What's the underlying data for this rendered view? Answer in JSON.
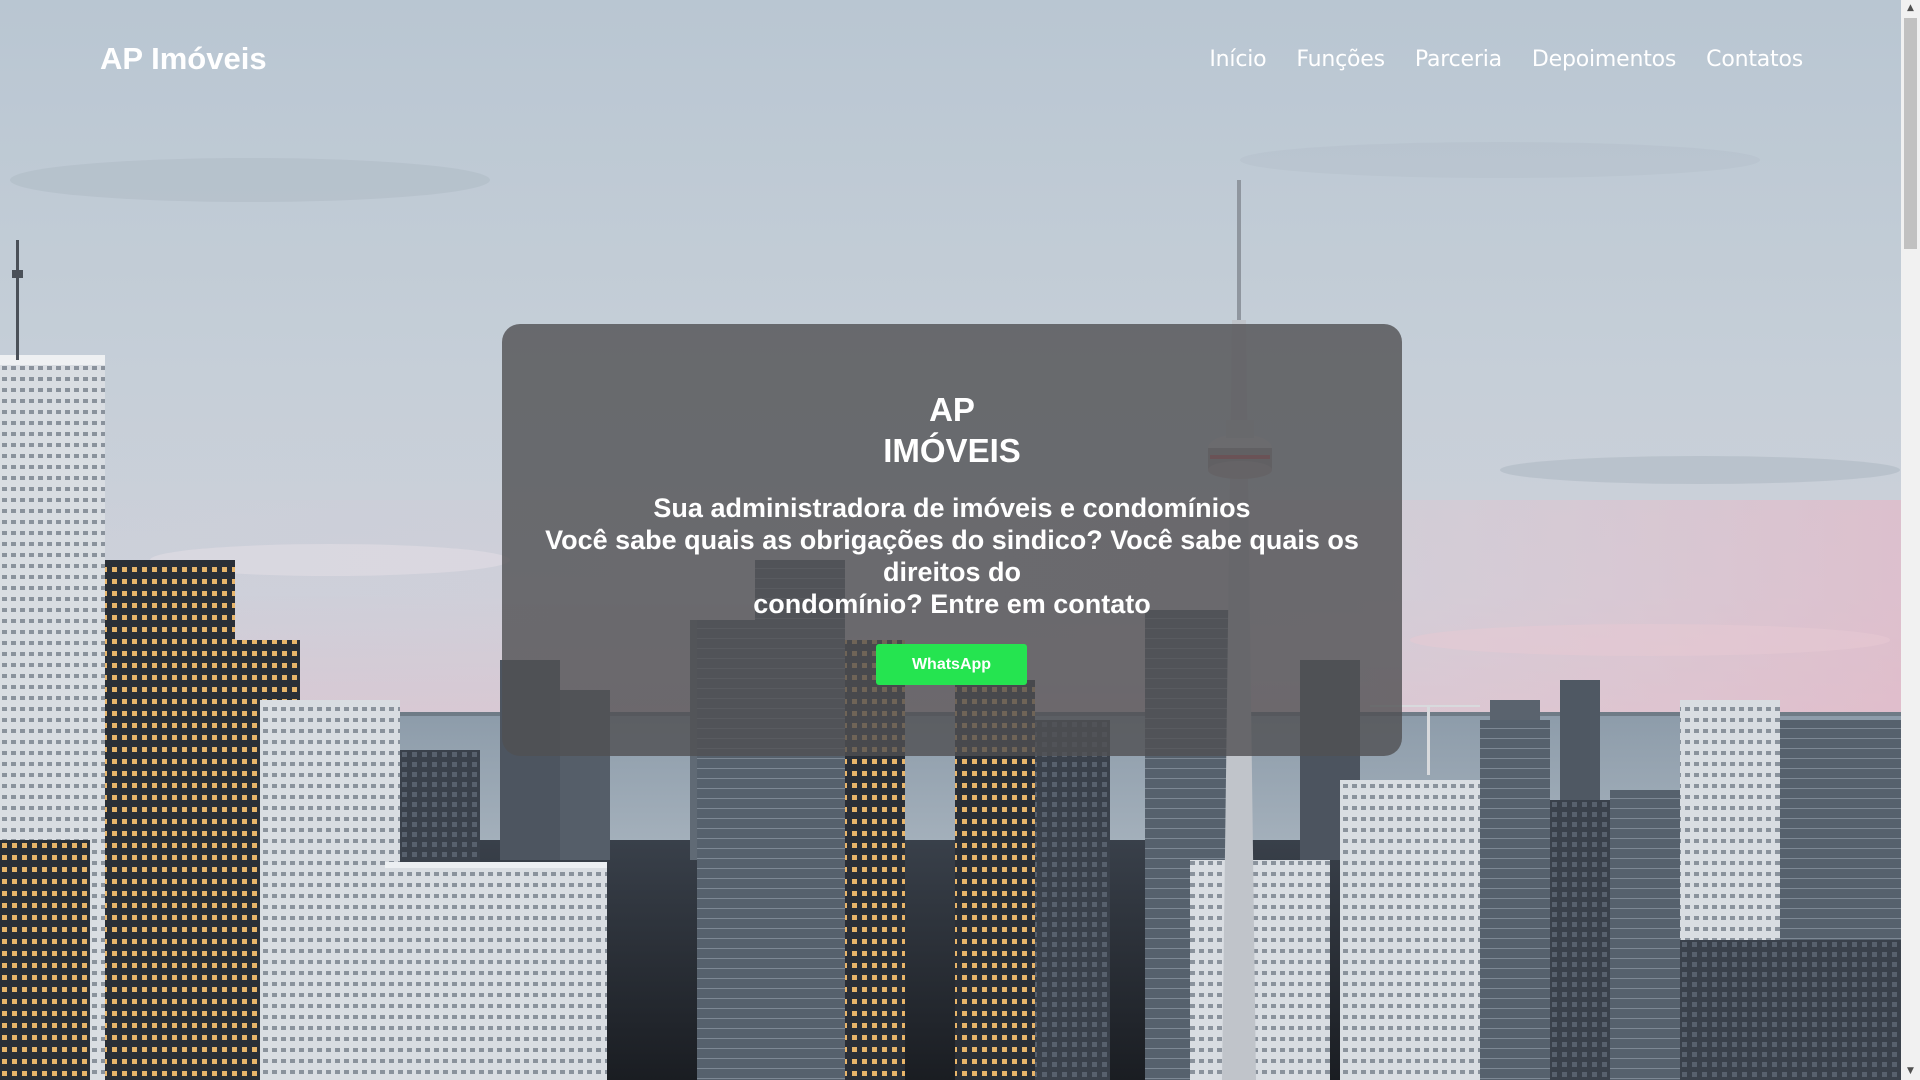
{
  "header": {
    "brand": "AP Imóveis",
    "nav": [
      {
        "label": "Início"
      },
      {
        "label": "Funções"
      },
      {
        "label": "Parceria"
      },
      {
        "label": "Depoimentos"
      },
      {
        "label": "Contatos"
      }
    ]
  },
  "hero": {
    "title_line1": "AP",
    "title_line2": "IMÓVEIS",
    "subtitle": "Sua administradora de imóveis e condomínios",
    "question_line1": "Você sabe quais as obrigações do sindico? Você sabe quais os direitos do",
    "question_line2": "condomínio? Entre em contato",
    "button_label": "WhatsApp"
  },
  "colors": {
    "accent_green": "#25e450",
    "card_bg": "#505052",
    "text": "#ffffff"
  },
  "scrollbar": {
    "up_icon": "▲",
    "down_icon": "▼"
  }
}
